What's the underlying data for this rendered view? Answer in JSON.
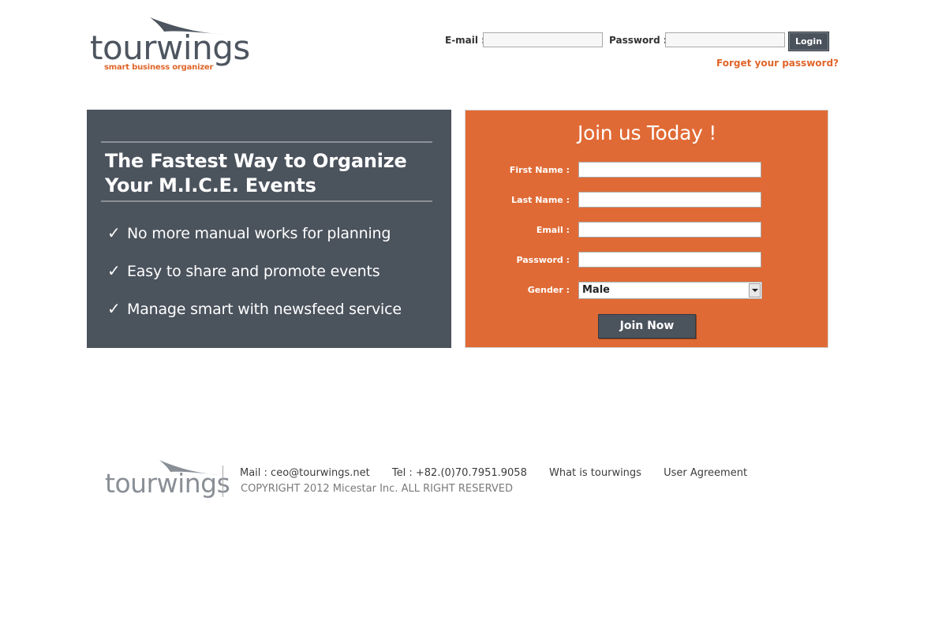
{
  "header": {
    "logo_text": "tourwings",
    "logo_tagline": "smart business organizer"
  },
  "login": {
    "email_label": "E-mail :",
    "email_value": "",
    "password_label": "Password :",
    "password_value": "",
    "login_label": "Login",
    "forgot_label": "Forget your password?"
  },
  "promo": {
    "headline_line1": "The Fastest Way to Organize",
    "headline_line2": "Your M.I.C.E. Events",
    "check_glyph": "✓",
    "features": [
      "No more manual works for planning",
      "Easy to share and promote events",
      "Manage smart with newsfeed service"
    ]
  },
  "join": {
    "title": "Join us Today !",
    "fields": [
      {
        "label": "First Name :",
        "value": ""
      },
      {
        "label": "Last Name :",
        "value": ""
      },
      {
        "label": "Email :",
        "value": ""
      },
      {
        "label": "Password :",
        "value": ""
      }
    ],
    "gender_label": "Gender :",
    "gender_value": "Male",
    "join_label": "Join Now"
  },
  "footer": {
    "logo_text": "tourwings",
    "mail": "Mail : ceo@tourwings.net",
    "tel": "Tel : +82.(0)70.7951.9058",
    "what_is": "What is tourwings",
    "user_agreement": "User Agreement",
    "copyright": "COPYRIGHT 2012 Micestar Inc. ALL RIGHT RESERVED"
  },
  "colors": {
    "brand_orange": "#e06a35",
    "brand_slate": "#4b535d"
  }
}
